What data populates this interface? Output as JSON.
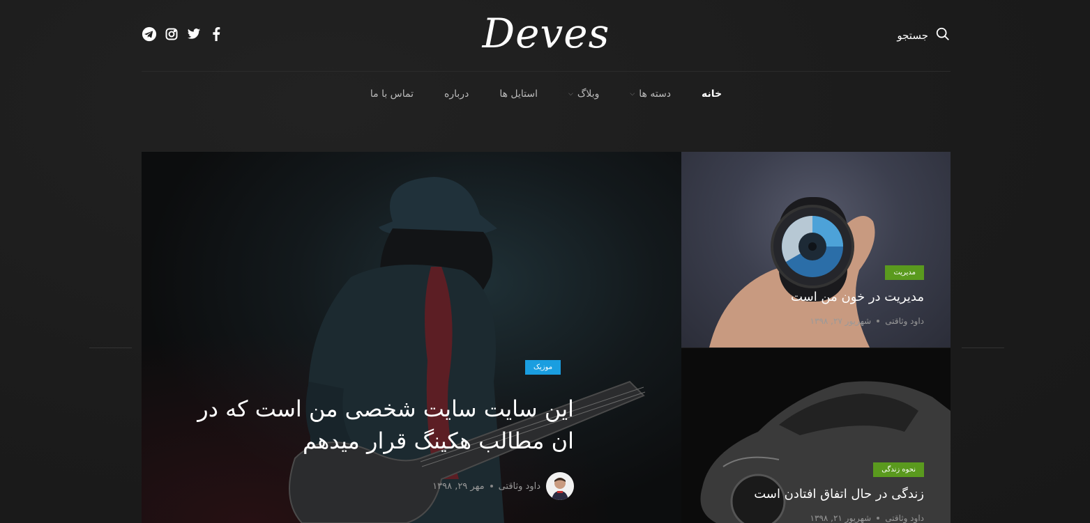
{
  "header": {
    "logo": "Deves",
    "search_label": "جستجو",
    "social_icons": [
      "facebook-icon",
      "twitter-icon",
      "instagram-icon",
      "telegram-icon"
    ]
  },
  "nav": {
    "items": [
      {
        "label": "خانه",
        "active": true,
        "dropdown": false
      },
      {
        "label": "دسته ها",
        "active": false,
        "dropdown": true
      },
      {
        "label": "وبلاگ",
        "active": false,
        "dropdown": true
      },
      {
        "label": "استایل ها",
        "active": false,
        "dropdown": false
      },
      {
        "label": "درباره",
        "active": false,
        "dropdown": false
      },
      {
        "label": "تماس با ما",
        "active": false,
        "dropdown": false
      }
    ]
  },
  "featured": {
    "category": "موزیک",
    "category_color": "#1a9ee0",
    "title": "این سایت سایت شخصی من است که در ان مطالب هکینگ قرار میدهم",
    "author": "داود وثاقتی",
    "date": "مهر ۲۹, ۱۳۹۸"
  },
  "cards": [
    {
      "category": "مدیریت",
      "category_color": "#5a9a1e",
      "title": "مدیریت در خون من است",
      "author": "داود وثاقتی",
      "date": "شهریور ۲۷, ۱۳۹۸"
    },
    {
      "category": "نحوه زندگی",
      "category_color": "#5a9a1e",
      "title": "زندگی در حال اتفاق افتادن است",
      "author": "داود وثاقتی",
      "date": "شهریور ۲۱, ۱۳۹۸"
    }
  ]
}
